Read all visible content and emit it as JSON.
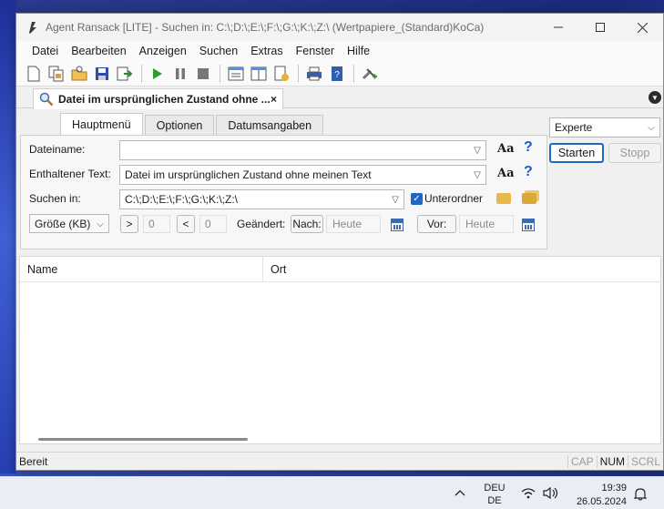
{
  "window": {
    "title": "Agent Ransack [LITE] - Suchen in: C:\\;D:\\;E:\\;F:\\;G:\\;K:\\;Z:\\ (Wertpapiere_(Standard)KoCa)",
    "controls": [
      "minimize",
      "maximize",
      "close"
    ]
  },
  "menu": [
    "Datei",
    "Bearbeiten",
    "Anzeigen",
    "Suchen",
    "Extras",
    "Fenster",
    "Hilfe"
  ],
  "toolbar_icons": [
    "new-search-icon",
    "copy-icon",
    "open-icon",
    "save-icon",
    "export-icon",
    "start-icon",
    "pause-icon",
    "stop-icon",
    "results-view-icon",
    "columns-icon",
    "report-icon",
    "print-icon",
    "help-book-icon",
    "tools-icon"
  ],
  "doc_tab": {
    "label": "Datei im ursprünglichen Zustand ohne ...",
    "close": "×"
  },
  "form_tabs": [
    "Hauptmenü",
    "Optionen",
    "Datumsangaben"
  ],
  "form": {
    "filename_label": "Dateiname:",
    "filename_value": "",
    "content_label": "Enthaltener Text:",
    "content_value": "Datei im ursprünglichen Zustand ohne meinen Text",
    "lookin_label": "Suchen in:",
    "lookin_value": "C:\\;D:\\;E:\\;F:\\;G:\\;K:\\;Z:\\",
    "case_glyph": "Aa",
    "help_glyph": "?",
    "subfolders_label": "Unterordner",
    "subfolders_checked": true,
    "size_unit": "Größe (KB)",
    "gt_label": ">",
    "gt_value": "0",
    "lt_label": "<",
    "lt_value": "0",
    "modified_label": "Geändert:",
    "after_label": "Nach:",
    "after_value": "Heute",
    "before_label": "Vor:",
    "before_value": "Heute"
  },
  "right_panel": {
    "mode": "Experte",
    "start_label": "Starten",
    "stop_label": "Stopp"
  },
  "results": {
    "columns": [
      "Name",
      "Ort"
    ]
  },
  "status": {
    "text": "Bereit",
    "keys": [
      {
        "label": "CAP",
        "on": false
      },
      {
        "label": "NUM",
        "on": true
      },
      {
        "label": "SCRL",
        "on": false
      }
    ]
  },
  "taskbar": {
    "lang_line1": "DEU",
    "lang_line2": "DE",
    "time": "19:39",
    "date": "26.05.2024"
  }
}
